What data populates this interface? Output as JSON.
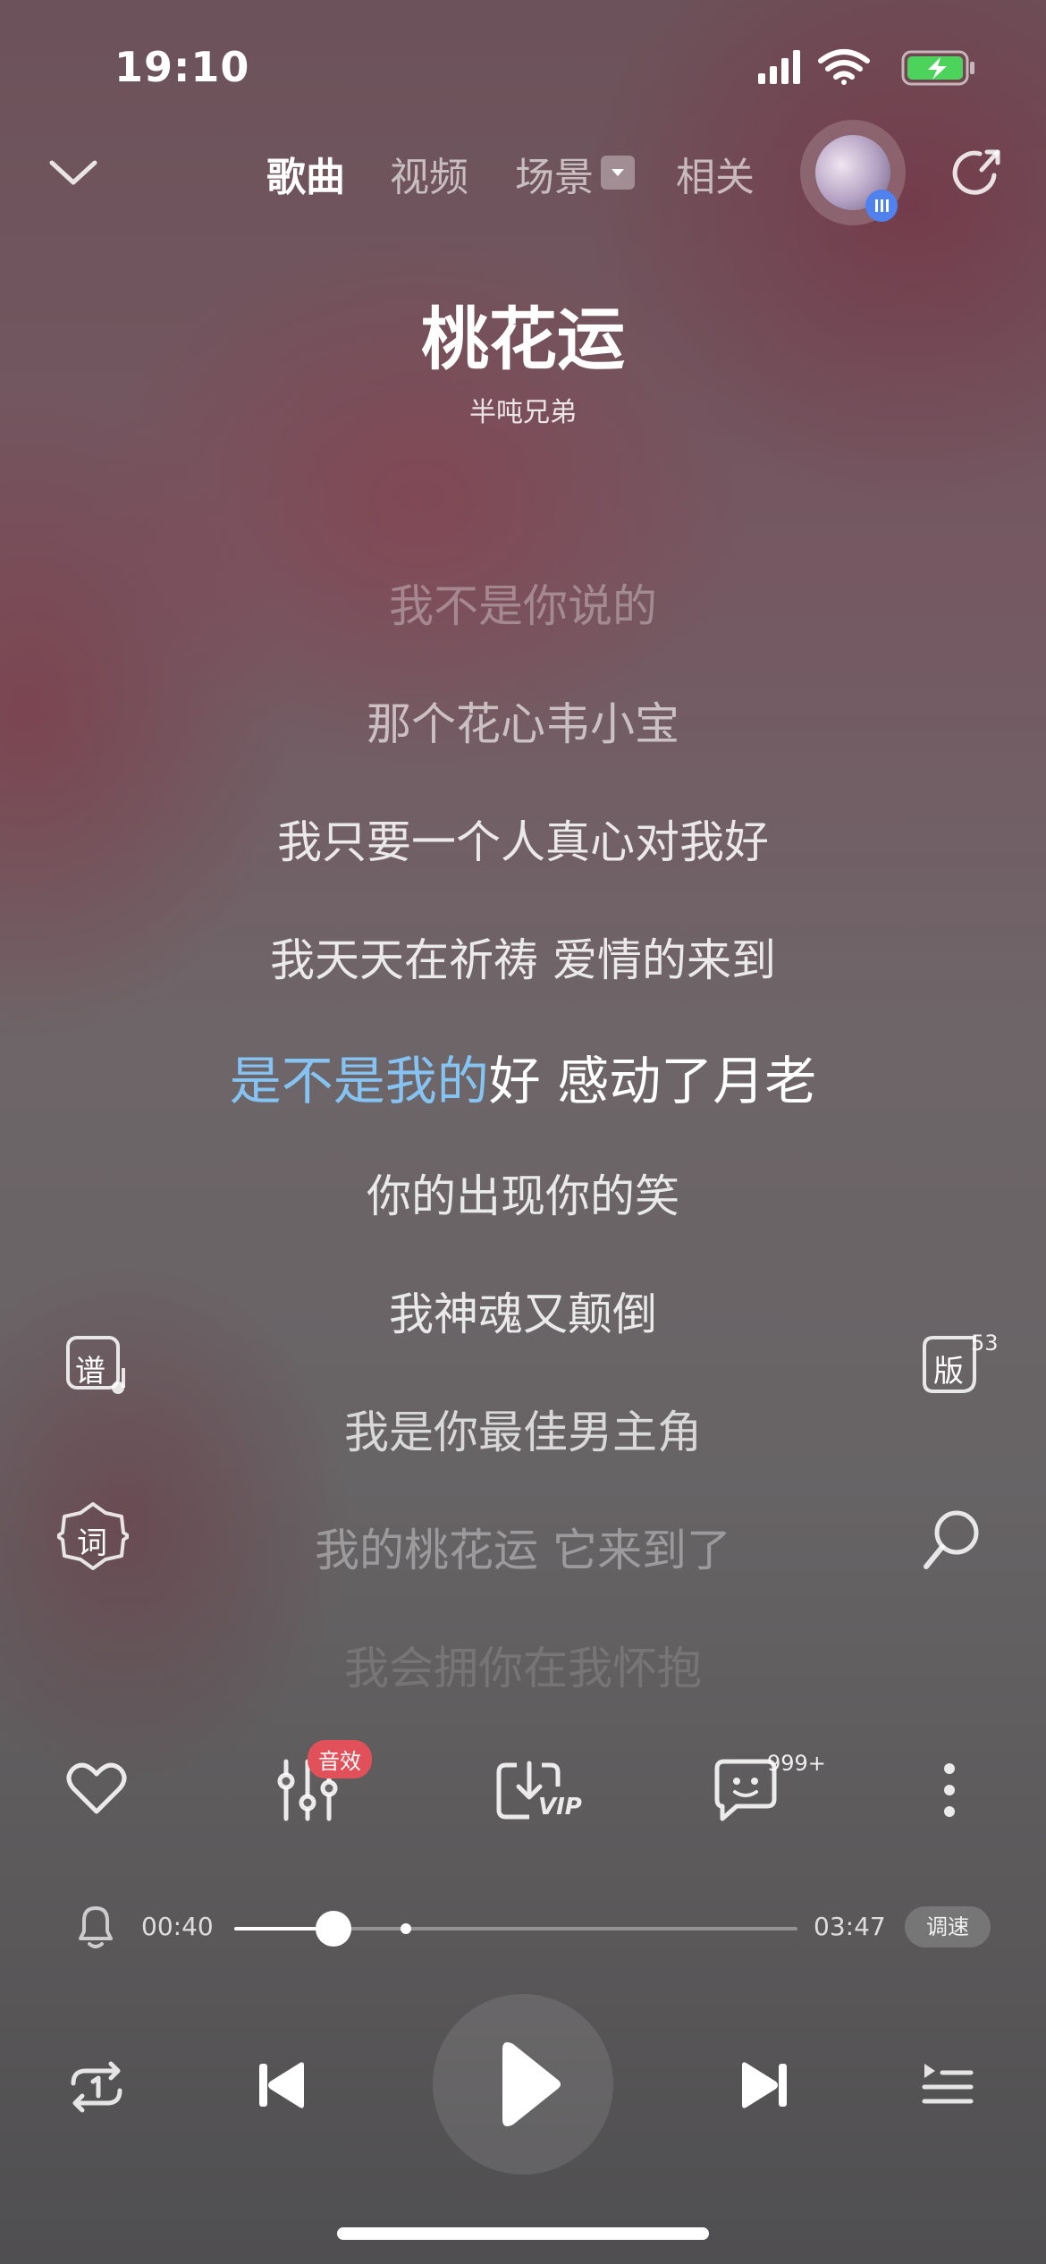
{
  "status_bar": {
    "time": "19:10"
  },
  "nav": {
    "tabs": [
      "歌曲",
      "视频",
      "场景",
      "相关"
    ],
    "active_tab": "歌曲"
  },
  "song": {
    "title": "桃花运",
    "artist": "半吨兄弟"
  },
  "lyrics": {
    "lines": [
      "我不是你说的",
      "那个花心韦小宝",
      "我只要一个人真心对我好",
      "我天天在祈祷 爱情的来到"
    ],
    "current_sung": "是不是我的",
    "current_rest": "好 感动了月老",
    "after": [
      "你的出现你的笑",
      "我神魂又颠倒",
      "我是你最佳男主角",
      "我的桃花运 它来到了",
      "我会拥你在我怀抱"
    ]
  },
  "side_buttons": {
    "score": "谱",
    "lyrics_btn": "词",
    "version": "版",
    "version_count": "53"
  },
  "actions": {
    "sound_effect_badge": "音效",
    "vip": "VIP",
    "comment_count": "999+"
  },
  "progress": {
    "current": "00:40",
    "total": "03:47",
    "fraction": 0.176,
    "speed_label": "调速"
  },
  "colors": {
    "highlight": "#85c3f2",
    "badge": "#e25159",
    "avatar_badge": "#4f82ee"
  }
}
